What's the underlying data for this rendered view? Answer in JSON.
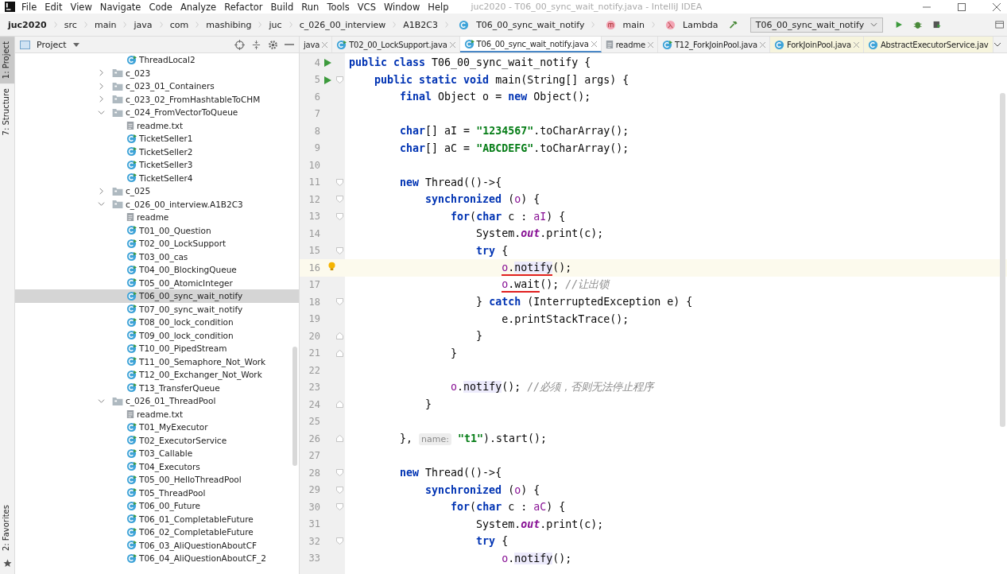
{
  "window": {
    "title": "juc2020 - T06_00_sync_wait_notify.java - IntelliJ IDEA"
  },
  "menu": [
    "File",
    "Edit",
    "View",
    "Navigate",
    "Code",
    "Analyze",
    "Refactor",
    "Build",
    "Run",
    "Tools",
    "VCS",
    "Window",
    "Help"
  ],
  "breadcrumbs": [
    {
      "label": "juc2020",
      "kind": "project"
    },
    {
      "label": "src",
      "kind": "plain"
    },
    {
      "label": "main",
      "kind": "plain"
    },
    {
      "label": "java",
      "kind": "plain"
    },
    {
      "label": "com",
      "kind": "plain"
    },
    {
      "label": "mashibing",
      "kind": "plain"
    },
    {
      "label": "juc",
      "kind": "plain"
    },
    {
      "label": "c_026_00_interview",
      "kind": "plain"
    },
    {
      "label": "A1B2C3",
      "kind": "plain"
    },
    {
      "label": "T06_00_sync_wait_notify",
      "kind": "class"
    },
    {
      "label": "main",
      "kind": "method"
    },
    {
      "label": "Lambda",
      "kind": "lambda"
    }
  ],
  "run_config": "T06_00_sync_wait_notify",
  "tool_stripe": [
    {
      "label": "1: Project",
      "selected": true
    },
    {
      "label": "7: Structure",
      "selected": false
    }
  ],
  "favorites": {
    "label": "2: Favorites"
  },
  "project_panel": {
    "title": "Project"
  },
  "tree": {
    "leading_items": [
      {
        "label": "ThreadLocal2",
        "kind": "class",
        "selected": false
      }
    ],
    "items": [
      {
        "label": "c_023",
        "kind": "folder",
        "expanded": false,
        "selected": false
      },
      {
        "label": "c_023_01_Containers",
        "kind": "folder",
        "expanded": false,
        "selected": false
      },
      {
        "label": "c_023_02_FromHashtableToCHM",
        "kind": "folder",
        "expanded": false,
        "selected": false
      },
      {
        "label": "c_024_FromVectorToQueue",
        "kind": "folder",
        "expanded": true,
        "selected": false,
        "children": [
          {
            "label": "readme.txt",
            "kind": "text",
            "selected": false
          },
          {
            "label": "TicketSeller1",
            "kind": "class",
            "selected": false
          },
          {
            "label": "TicketSeller2",
            "kind": "class",
            "selected": false
          },
          {
            "label": "TicketSeller3",
            "kind": "class",
            "selected": false
          },
          {
            "label": "TicketSeller4",
            "kind": "class",
            "selected": false
          }
        ]
      },
      {
        "label": "c_025",
        "kind": "folder",
        "expanded": false,
        "selected": false
      },
      {
        "label": "c_026_00_interview.A1B2C3",
        "kind": "folder",
        "expanded": true,
        "selected": false,
        "children": [
          {
            "label": "readme",
            "kind": "text",
            "selected": false
          },
          {
            "label": "T01_00_Question",
            "kind": "class",
            "selected": false
          },
          {
            "label": "T02_00_LockSupport",
            "kind": "class",
            "selected": false
          },
          {
            "label": "T03_00_cas",
            "kind": "class",
            "selected": false
          },
          {
            "label": "T04_00_BlockingQueue",
            "kind": "class",
            "selected": false
          },
          {
            "label": "T05_00_AtomicInteger",
            "kind": "class",
            "selected": false
          },
          {
            "label": "T06_00_sync_wait_notify",
            "kind": "class",
            "selected": true
          },
          {
            "label": "T07_00_sync_wait_notify",
            "kind": "class",
            "selected": false
          },
          {
            "label": "T08_00_lock_condition",
            "kind": "class",
            "selected": false
          },
          {
            "label": "T09_00_lock_condition",
            "kind": "class",
            "selected": false
          },
          {
            "label": "T10_00_PipedStream",
            "kind": "class",
            "selected": false
          },
          {
            "label": "T11_00_Semaphore_Not_Work",
            "kind": "class",
            "selected": false
          },
          {
            "label": "T12_00_Exchanger_Not_Work",
            "kind": "class",
            "selected": false
          },
          {
            "label": "T13_TransferQueue",
            "kind": "class",
            "selected": false
          }
        ]
      },
      {
        "label": "c_026_01_ThreadPool",
        "kind": "folder",
        "expanded": true,
        "selected": false,
        "children": [
          {
            "label": "readme.txt",
            "kind": "text",
            "selected": false
          },
          {
            "label": "T01_MyExecutor",
            "kind": "class",
            "selected": false
          },
          {
            "label": "T02_ExecutorService",
            "kind": "class",
            "selected": false
          },
          {
            "label": "T03_Callable",
            "kind": "class",
            "selected": false
          },
          {
            "label": "T04_Executors",
            "kind": "class",
            "selected": false
          },
          {
            "label": "T05_00_HelloThreadPool",
            "kind": "class",
            "selected": false
          },
          {
            "label": "T05_ThreadPool",
            "kind": "class",
            "selected": false
          },
          {
            "label": "T06_00_Future",
            "kind": "class",
            "selected": false
          },
          {
            "label": "T06_01_CompletableFuture",
            "kind": "class",
            "selected": false
          },
          {
            "label": "T06_02_CompletableFuture",
            "kind": "class",
            "selected": false
          },
          {
            "label": "T06_03_AliQuestionAboutCF",
            "kind": "class",
            "selected": false
          },
          {
            "label": "T06_04_AliQuestionAboutCF_2",
            "kind": "class",
            "selected": false
          }
        ]
      }
    ]
  },
  "tabs": [
    {
      "label": "java",
      "kind": "none",
      "selected": false
    },
    {
      "label": "T02_00_LockSupport.java",
      "kind": "class",
      "selected": false
    },
    {
      "label": "T06_00_sync_wait_notify.java",
      "kind": "class",
      "selected": true
    },
    {
      "label": "readme",
      "kind": "text",
      "selected": false
    },
    {
      "label": "T12_ForkJoinPool.java",
      "kind": "class",
      "selected": false
    },
    {
      "label": "ForkJoinPool.java",
      "kind": "library",
      "selected": false
    },
    {
      "label": "AbstractExecutorService.jav",
      "kind": "library",
      "selected": false
    }
  ],
  "code_lines": [
    {
      "number": "4",
      "run_marker": true,
      "tokens": [
        {
          "kind": "kw",
          "text": "public class"
        },
        {
          "kind": "plain",
          "text": " T06_00_sync_wait_notify {"
        }
      ]
    },
    {
      "number": "5",
      "run_marker": true,
      "fold_start": true,
      "tokens": [
        {
          "kind": "kw",
          "text": "    public static void"
        },
        {
          "kind": "plain",
          "text": " main(String[] args) {"
        }
      ]
    },
    {
      "number": "6",
      "tokens": [
        {
          "kind": "kw",
          "text": "        final"
        },
        {
          "kind": "plain",
          "text": " Object o = "
        },
        {
          "kind": "kw",
          "text": "new"
        },
        {
          "kind": "plain",
          "text": " Object();"
        }
      ]
    },
    {
      "number": "7"
    },
    {
      "number": "8",
      "tokens": [
        {
          "kind": "kw",
          "text": "        char"
        },
        {
          "kind": "plain",
          "text": "[] aI = "
        },
        {
          "kind": "str",
          "text": "\"1234567\""
        },
        {
          "kind": "plain",
          "text": ".toCharArray();"
        }
      ]
    },
    {
      "number": "9",
      "tokens": [
        {
          "kind": "kw",
          "text": "        char"
        },
        {
          "kind": "plain",
          "text": "[] aC = "
        },
        {
          "kind": "str",
          "text": "\"ABCDEFG\""
        },
        {
          "kind": "plain",
          "text": ".toCharArray();"
        }
      ]
    },
    {
      "number": "10"
    },
    {
      "number": "11",
      "fold_start": true,
      "tokens": [
        {
          "kind": "kw",
          "text": "        new"
        },
        {
          "kind": "plain",
          "text": " Thread(()->{"
        }
      ]
    },
    {
      "number": "12",
      "fold_start": true,
      "tokens": [
        {
          "kind": "kw",
          "text": "            synchronized"
        },
        {
          "kind": "plain",
          "text": " ("
        },
        {
          "kind": "captured",
          "text": "o"
        },
        {
          "kind": "plain",
          "text": ") {"
        }
      ]
    },
    {
      "number": "13",
      "fold_start": true,
      "tokens": [
        {
          "kind": "kw",
          "text": "                for"
        },
        {
          "kind": "plain",
          "text": "("
        },
        {
          "kind": "kw",
          "text": "char"
        },
        {
          "kind": "plain",
          "text": " c : "
        },
        {
          "kind": "captured",
          "text": "aI"
        },
        {
          "kind": "plain",
          "text": ") {"
        }
      ]
    },
    {
      "number": "14",
      "tokens": [
        {
          "kind": "plain",
          "text": "                    System."
        },
        {
          "kind": "field",
          "text": "out"
        },
        {
          "kind": "plain",
          "text": ".print(c);"
        }
      ]
    },
    {
      "number": "15",
      "fold_start": true,
      "tokens": [
        {
          "kind": "kw",
          "text": "                    try"
        },
        {
          "kind": "plain",
          "text": " {"
        }
      ]
    },
    {
      "number": "16",
      "bulb": true,
      "current": true,
      "tokens": [
        {
          "kind": "captured",
          "text": "                        o",
          "underline": true
        },
        {
          "kind": "plain",
          "text": ".",
          "underline": true
        },
        {
          "kind": "usage",
          "text": "notify",
          "underline": true
        },
        {
          "kind": "plain",
          "text": "();"
        }
      ]
    },
    {
      "number": "17",
      "tokens": [
        {
          "kind": "captured",
          "text": "                        o",
          "underline": true
        },
        {
          "kind": "plain",
          "text": ".wait",
          "underline": true
        },
        {
          "kind": "plain",
          "text": "(); "
        },
        {
          "kind": "comment",
          "text": "//让出锁"
        }
      ]
    },
    {
      "number": "18",
      "fold_start": true,
      "tokens": [
        {
          "kind": "plain",
          "text": "                    } "
        },
        {
          "kind": "kw",
          "text": "catch"
        },
        {
          "kind": "plain",
          "text": " (InterruptedException e) {"
        }
      ]
    },
    {
      "number": "19",
      "tokens": [
        {
          "kind": "plain",
          "text": "                        e.printStackTrace();"
        }
      ]
    },
    {
      "number": "20",
      "fold_end": true,
      "tokens": [
        {
          "kind": "plain",
          "text": "                    }"
        }
      ]
    },
    {
      "number": "21",
      "fold_end": true,
      "tokens": [
        {
          "kind": "plain",
          "text": "                }"
        }
      ]
    },
    {
      "number": "22"
    },
    {
      "number": "23",
      "tokens": [
        {
          "kind": "captured",
          "text": "                o"
        },
        {
          "kind": "plain",
          "text": "."
        },
        {
          "kind": "usage",
          "text": "notify"
        },
        {
          "kind": "plain",
          "text": "(); "
        },
        {
          "kind": "comment",
          "text": "//必须，否则无法停止程序"
        }
      ]
    },
    {
      "number": "24",
      "fold_end": true,
      "tokens": [
        {
          "kind": "plain",
          "text": "            }"
        }
      ]
    },
    {
      "number": "25"
    },
    {
      "number": "26",
      "fold_end": true,
      "tokens": [
        {
          "kind": "plain",
          "text": "        }, "
        },
        {
          "kind": "hint",
          "text": "name:"
        },
        {
          "kind": "str",
          "text": " \"t1\""
        },
        {
          "kind": "plain",
          "text": ").start();"
        }
      ]
    },
    {
      "number": "27"
    },
    {
      "number": "28",
      "fold_start": true,
      "tokens": [
        {
          "kind": "kw",
          "text": "        new"
        },
        {
          "kind": "plain",
          "text": " Thread(()->{"
        }
      ]
    },
    {
      "number": "29",
      "fold_start": true,
      "tokens": [
        {
          "kind": "kw",
          "text": "            synchronized"
        },
        {
          "kind": "plain",
          "text": " ("
        },
        {
          "kind": "captured",
          "text": "o"
        },
        {
          "kind": "plain",
          "text": ") {"
        }
      ]
    },
    {
      "number": "30",
      "fold_start": true,
      "tokens": [
        {
          "kind": "kw",
          "text": "                for"
        },
        {
          "kind": "plain",
          "text": "("
        },
        {
          "kind": "kw",
          "text": "char"
        },
        {
          "kind": "plain",
          "text": " c : "
        },
        {
          "kind": "captured",
          "text": "aC"
        },
        {
          "kind": "plain",
          "text": ") {"
        }
      ]
    },
    {
      "number": "31",
      "tokens": [
        {
          "kind": "plain",
          "text": "                    System."
        },
        {
          "kind": "field",
          "text": "out"
        },
        {
          "kind": "plain",
          "text": ".print(c);"
        }
      ]
    },
    {
      "number": "32",
      "fold_start": true,
      "tokens": [
        {
          "kind": "kw",
          "text": "                    try"
        },
        {
          "kind": "plain",
          "text": " {"
        }
      ]
    },
    {
      "number": "33",
      "tokens": [
        {
          "kind": "captured",
          "text": "                        o"
        },
        {
          "kind": "plain",
          "text": "."
        },
        {
          "kind": "usage",
          "text": "notify"
        },
        {
          "kind": "plain",
          "text": "();"
        }
      ]
    }
  ]
}
